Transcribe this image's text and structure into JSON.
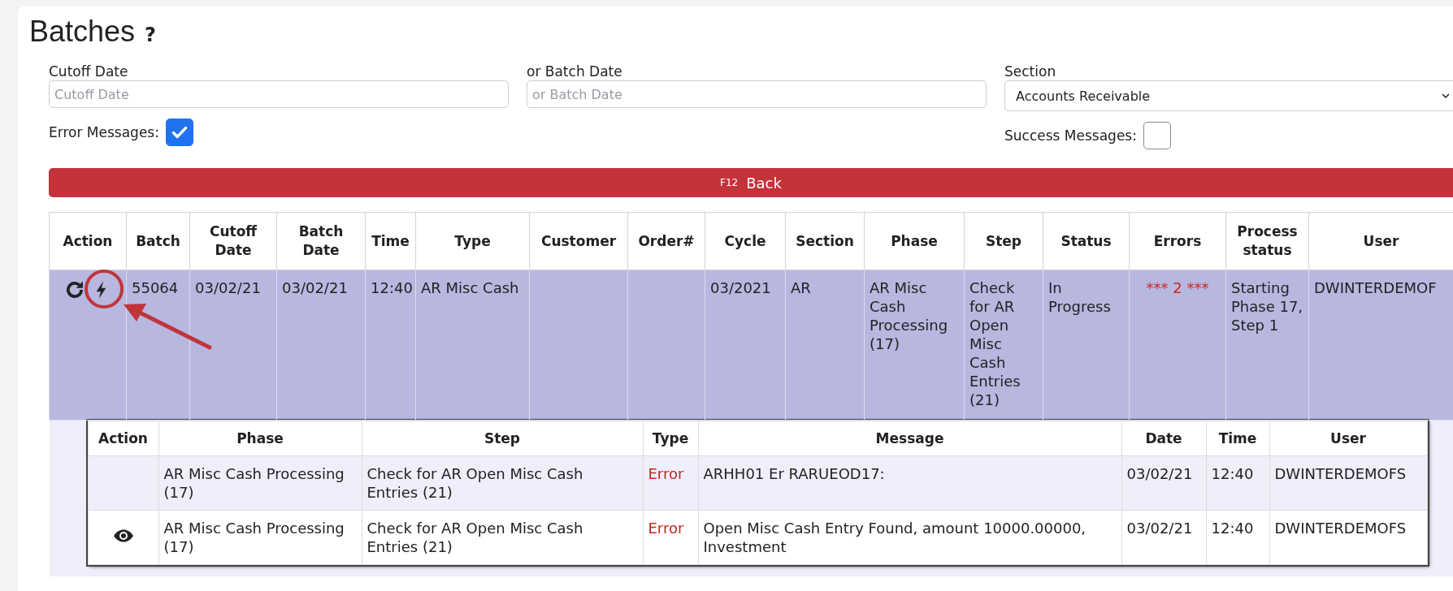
{
  "page": {
    "title": "Batches",
    "help": "?"
  },
  "filters": {
    "cutoff_date": {
      "label": "Cutoff Date",
      "placeholder": "Cutoff Date"
    },
    "batch_date": {
      "label": "or Batch Date",
      "placeholder": "or Batch Date"
    },
    "section": {
      "label": "Section",
      "value": "Accounts Receivable"
    },
    "error_messages": {
      "label": "Error Messages:",
      "checked": true
    },
    "success_messages": {
      "label": "Success Messages:",
      "checked": false
    }
  },
  "back_button": {
    "shortcut": "F12",
    "label": "Back"
  },
  "batches": {
    "columns": [
      "Action",
      "Batch",
      "Cutoff Date",
      "Batch Date",
      "Time",
      "Type",
      "Customer",
      "Order#",
      "Cycle",
      "Section",
      "Phase",
      "Step",
      "Status",
      "Errors",
      "Process status",
      "User"
    ],
    "rows": [
      {
        "expanded": true,
        "batch": "55064",
        "cutoff_date": "03/02/21",
        "batch_date": "03/02/21",
        "time": "12:40",
        "type": "AR Misc Cash",
        "customer": "",
        "order": "",
        "cycle": "03/2021",
        "section": "AR",
        "phase": "AR Misc Cash Processing (17)",
        "step": "Check for AR Open Misc Cash Entries (21)",
        "status": "In Progress",
        "errors": "*** 2 ***",
        "process_status": "Starting Phase 17, Step 1",
        "user": "DWINTERDEMOF",
        "messages": {
          "columns": [
            "Action",
            "Phase",
            "Step",
            "Type",
            "Message",
            "Date",
            "Time",
            "User"
          ],
          "rows": [
            {
              "kind": "plain",
              "phase": "AR Misc Cash Processing (17)",
              "step": "Check for AR Open Misc Cash Entries (21)",
              "type": "Error",
              "message": "ARHH01 Er RARUEOD17:",
              "date": "03/02/21",
              "time": "12:40",
              "user": "DWINTERDEMOFS"
            },
            {
              "kind": "viewable",
              "phase": "AR Misc Cash Processing (17)",
              "step": "Check for AR Open Misc Cash Entries (21)",
              "type": "Error",
              "message": "Open Misc Cash Entry Found, amount 10000.00000, Investment",
              "date": "03/02/21",
              "time": "12:40",
              "user": "DWINTERDEMOFS"
            }
          ]
        }
      }
    ]
  }
}
